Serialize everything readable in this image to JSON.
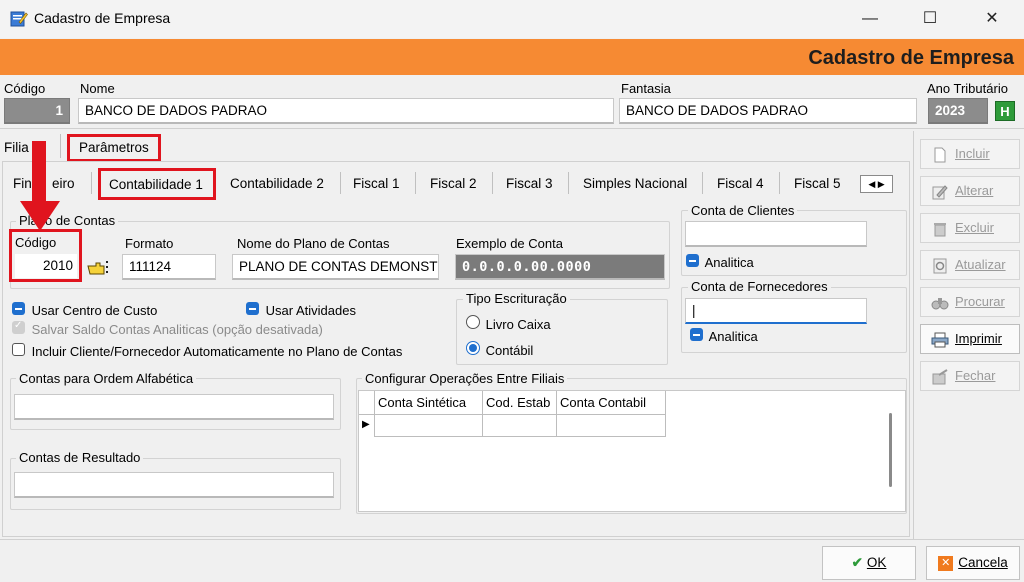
{
  "window": {
    "title": "Cadastro de Empresa",
    "minimize": "—",
    "maximize": "☐",
    "close": "✕"
  },
  "banner": {
    "title": "Cadastro de Empresa"
  },
  "header": {
    "codigo_label": "Código",
    "codigo_value": "1",
    "nome_label": "Nome",
    "nome_value": "BANCO DE DADOS PADRAO",
    "fantasia_label": "Fantasia",
    "fantasia_value": "BANCO DE DADOS PADRAO",
    "ano_label": "Ano Tributário",
    "ano_value": "2023",
    "ano_btn": "H"
  },
  "top_tabs": [
    "Filia",
    "Parâmetros"
  ],
  "sub_tabs": [
    "Fin",
    "eiro",
    "Contabilidade 1",
    "Contabilidade 2",
    "Fiscal 1",
    "Fiscal 2",
    "Fiscal 3",
    "Simples Nacional",
    "Fiscal 4",
    "Fiscal 5"
  ],
  "plano": {
    "group_title": "Plano de Contas",
    "codigo_label": "Código",
    "codigo_value": "2010",
    "formato_label": "Formato",
    "formato_value": "111124",
    "nome_label": "Nome do Plano de Contas",
    "nome_value": "PLANO DE CONTAS DEMONST",
    "exemplo_label": "Exemplo de Conta",
    "exemplo_value": "0.0.0.0.00.0000"
  },
  "options": {
    "centro_custo": "Usar Centro de Custo",
    "atividades": "Usar Atividades",
    "salvar_saldo": "Salvar Saldo  Contas Analiticas (opção desativada)",
    "incluir_cliente": "Incluir Cliente/Fornecedor Automaticamente no Plano de Contas"
  },
  "tipo": {
    "title": "Tipo Escrituração",
    "livro": "Livro Caixa",
    "contabil": "Contábil"
  },
  "clientes": {
    "title": "Conta de Clientes",
    "analitica": "Analitica"
  },
  "fornecedores": {
    "title": "Conta de Fornecedores",
    "value": "|",
    "analitica": "Analitica"
  },
  "ordem": {
    "title": "Contas para Ordem  Alfabética"
  },
  "resultado": {
    "title": "Contas de Resultado"
  },
  "filiais": {
    "title": "Configurar Operações Entre Filiais",
    "columns": [
      "Conta Sintética",
      "Cod. Estab",
      "Conta Contabil"
    ]
  },
  "side_buttons": [
    {
      "label": "Incluir",
      "icon": "new-doc-icon"
    },
    {
      "label": "Alterar",
      "icon": "edit-icon"
    },
    {
      "label": "Excluir",
      "icon": "trash-icon"
    },
    {
      "label": "Atualizar",
      "icon": "refresh-icon"
    },
    {
      "label": "Procurar",
      "icon": "binoculars-icon"
    },
    {
      "label": "Imprimir",
      "icon": "printer-icon"
    },
    {
      "label": "Fechar",
      "icon": "exit-icon"
    }
  ],
  "bottom": {
    "ok": "OK",
    "cancel": "Cancela"
  },
  "colors": {
    "banner": "#f68a33",
    "annotation": "#e0141e",
    "accent": "#1f6fce"
  }
}
